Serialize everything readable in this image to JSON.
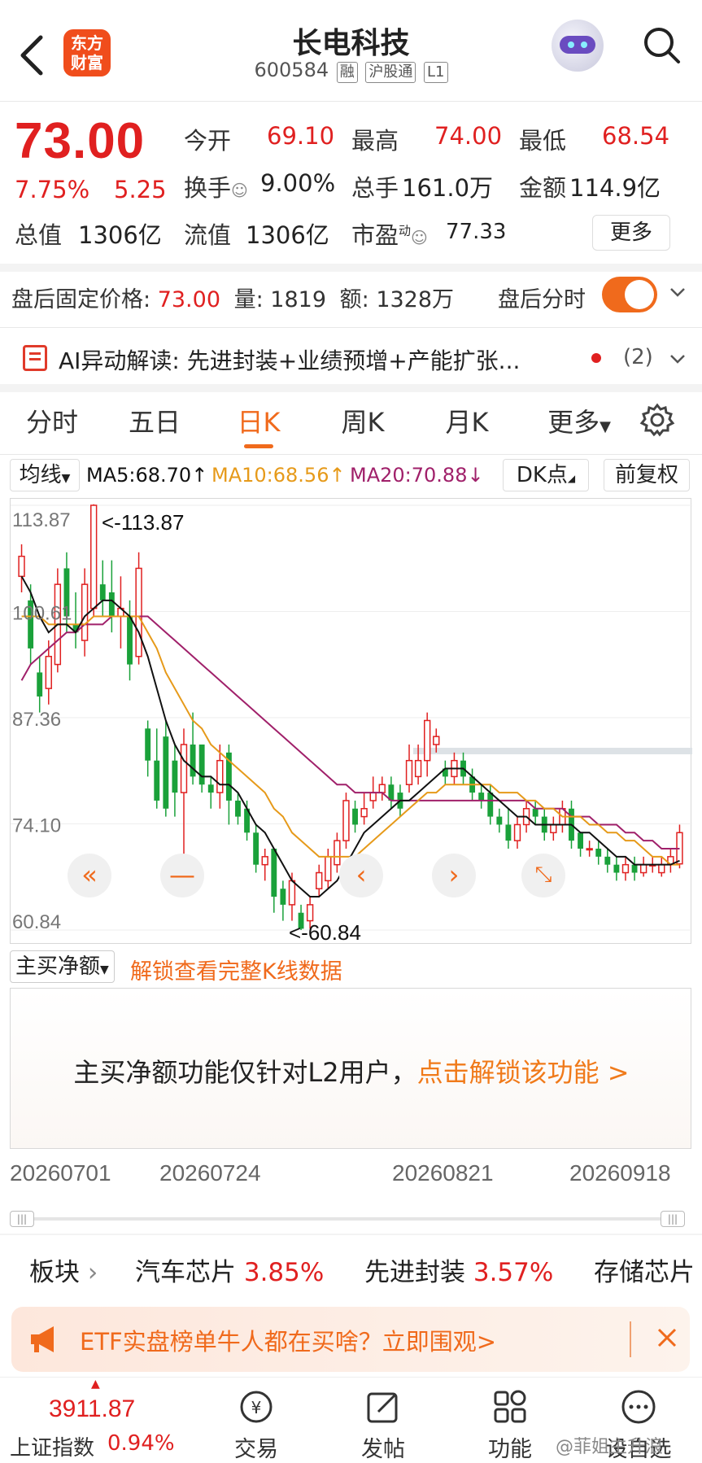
{
  "header": {
    "app_logo_line1": "东方",
    "app_logo_line2": "财富",
    "stock_name": "长电科技",
    "stock_code": "600584",
    "tag_rong": "融",
    "tag_hgt": "沪股通",
    "tag_level": "L1"
  },
  "quote": {
    "price": "73.00",
    "change_pct": "7.75%",
    "change_amt": "5.25",
    "open_label": "今开",
    "open": "69.10",
    "high_label": "最高",
    "high": "74.00",
    "low_label": "最低",
    "low": "68.54",
    "turnover_label": "换手",
    "turnover": "9.00%",
    "volume_label": "总手",
    "volume": "161.0万",
    "amount_label": "金额",
    "amount": "114.9亿",
    "mktcap_label": "总值",
    "mktcap": "1306亿",
    "float_label": "流值",
    "float_cap": "1306亿",
    "pe_label": "市盈",
    "pe_sup": "动",
    "pe": "77.33",
    "more_label": "更多"
  },
  "after_hours": {
    "price_label": "盘后固定价格:",
    "price": "73.00",
    "vol_label": "量:",
    "vol": "1819",
    "amt_label": "额:",
    "amt": "1328万",
    "toggle_label": "盘后分时",
    "toggle_on": true
  },
  "ai_row": {
    "text": "AI异动解读: 先进封装+业绩预增+产能扩张...",
    "count": "(2)"
  },
  "tabs": [
    {
      "label": "分时"
    },
    {
      "label": "五日"
    },
    {
      "label": "日K"
    },
    {
      "label": "周K"
    },
    {
      "label": "月K"
    },
    {
      "label": "更多"
    }
  ],
  "active_tab": "日K",
  "ma_bar": {
    "selector": "均线",
    "ma5": "MA5:68.70↑",
    "ma10": "MA10:68.56↑",
    "ma20": "MA20:70.88↓",
    "dk_label": "DK点",
    "adjust_label": "前复权"
  },
  "colors": {
    "up": "#e02020",
    "down": "#1aa13a",
    "accent": "#f06a1c",
    "ma5": "#111111",
    "ma10": "#e69a1a",
    "ma20": "#a0206a"
  },
  "chart_data": {
    "type": "candlestick",
    "y_ticks": [
      "113.87",
      "100.61",
      "87.36",
      "74.10",
      "60.84"
    ],
    "ylim": [
      60.84,
      113.87
    ],
    "max_label": "<-113.87",
    "min_label": "<-60.84",
    "x_labels": [
      "20260701",
      "20260724",
      "20260821",
      "20260918"
    ],
    "candles": [
      [
        105,
        107.5,
        103,
        109
      ],
      [
        102,
        96,
        94,
        104
      ],
      [
        93,
        90,
        88,
        95
      ],
      [
        91,
        95,
        89,
        97
      ],
      [
        94,
        104,
        93,
        106
      ],
      [
        106,
        100,
        98,
        108
      ],
      [
        99,
        98,
        96,
        103
      ],
      [
        97,
        104,
        95,
        106
      ],
      [
        101,
        113.87,
        100,
        114
      ],
      [
        104,
        102,
        100,
        107
      ],
      [
        103,
        100,
        98,
        107
      ],
      [
        100,
        101,
        96,
        105
      ],
      [
        100,
        94,
        92,
        102
      ],
      [
        95,
        106,
        94,
        108
      ],
      [
        86,
        82,
        80,
        87
      ],
      [
        82,
        77,
        76,
        86
      ],
      [
        85,
        76,
        75,
        87
      ],
      [
        82,
        78,
        75,
        84
      ],
      [
        78,
        84,
        70,
        86
      ],
      [
        84,
        80,
        79,
        88
      ],
      [
        84,
        79,
        78,
        84
      ],
      [
        79,
        78,
        76,
        80
      ],
      [
        78,
        82,
        76,
        84
      ],
      [
        83,
        77,
        74,
        84
      ],
      [
        77,
        75,
        74,
        78
      ],
      [
        76,
        73,
        72,
        77
      ],
      [
        73,
        69,
        68,
        74
      ],
      [
        69,
        70,
        67,
        71
      ],
      [
        71,
        65,
        63,
        71
      ],
      [
        66,
        64,
        62,
        67
      ],
      [
        64,
        67,
        62,
        68
      ],
      [
        63,
        61,
        60.84,
        64
      ],
      [
        62,
        64,
        61,
        65
      ],
      [
        66,
        68,
        65,
        69
      ],
      [
        67,
        70,
        66,
        71
      ],
      [
        69,
        72,
        68,
        73
      ],
      [
        72,
        77,
        71,
        78
      ],
      [
        76,
        74,
        73,
        77
      ],
      [
        75,
        76,
        74,
        78
      ],
      [
        77,
        78,
        76,
        80
      ],
      [
        78,
        79,
        77,
        80
      ],
      [
        79,
        77,
        76,
        80
      ],
      [
        78,
        76,
        75,
        79
      ],
      [
        79,
        82,
        78,
        84
      ],
      [
        80,
        82,
        79,
        84
      ],
      [
        82,
        87,
        80,
        88
      ],
      [
        84,
        85,
        83,
        86
      ],
      [
        81,
        80,
        79,
        82
      ],
      [
        80,
        82,
        79,
        83
      ],
      [
        82,
        80,
        79,
        83
      ],
      [
        80,
        78,
        77,
        81
      ],
      [
        78,
        77,
        76,
        79
      ],
      [
        78,
        75,
        74,
        79
      ],
      [
        75,
        74,
        73,
        76
      ],
      [
        74,
        72,
        71,
        76
      ],
      [
        72,
        74,
        71,
        75
      ],
      [
        74,
        76,
        73,
        77
      ],
      [
        76,
        75,
        74,
        77
      ],
      [
        75,
        73,
        72,
        76
      ],
      [
        73,
        74,
        72,
        75
      ],
      [
        74,
        76,
        73,
        77
      ],
      [
        76,
        72,
        71,
        77
      ],
      [
        73,
        71,
        70,
        73
      ],
      [
        71,
        71,
        70,
        72
      ],
      [
        71,
        70,
        69,
        72
      ],
      [
        70,
        69,
        68,
        71
      ],
      [
        69,
        68,
        67,
        70
      ],
      [
        68,
        69,
        67,
        70
      ],
      [
        69,
        68,
        67,
        70
      ],
      [
        68,
        69,
        67.5,
        70
      ],
      [
        69,
        69,
        68,
        70
      ],
      [
        68,
        69,
        67.5,
        70
      ],
      [
        69,
        70,
        68,
        71
      ],
      [
        69.1,
        73,
        68.54,
        74
      ]
    ],
    "ma5": [
      105,
      103,
      100,
      98,
      99,
      99,
      98,
      100,
      101,
      102,
      102,
      101,
      100,
      98,
      95,
      91,
      87,
      84,
      82,
      81,
      80,
      80,
      79,
      79,
      78,
      76,
      74,
      73,
      71,
      69,
      67,
      66,
      65,
      65,
      66,
      67,
      69,
      71,
      73,
      74,
      75,
      76,
      77,
      77,
      78,
      79,
      80,
      81,
      81,
      81,
      80,
      79,
      78,
      77,
      76,
      75,
      75,
      74,
      74,
      74,
      74,
      74,
      73,
      73,
      72,
      71,
      70,
      70,
      69,
      69,
      69,
      69,
      69,
      69.5
    ],
    "ma10": [
      100,
      100,
      100,
      99,
      99,
      99,
      99,
      99,
      100,
      100,
      100,
      100,
      100,
      100,
      98,
      96,
      93,
      91,
      89,
      87,
      86,
      84,
      83,
      82,
      81,
      80,
      79,
      78,
      76,
      75,
      73,
      72,
      71,
      70,
      70,
      70,
      70,
      70,
      71,
      72,
      73,
      74,
      75,
      76,
      77,
      78,
      78,
      79,
      79,
      79,
      79,
      79,
      79,
      78,
      78,
      78,
      77,
      77,
      76,
      76,
      75,
      75,
      75,
      74,
      74,
      73,
      73,
      72,
      72,
      71,
      70,
      70,
      69,
      69
    ],
    "ma20": [
      92,
      94,
      95,
      96,
      97,
      98,
      98,
      99,
      99,
      99,
      100,
      100,
      100,
      100,
      100,
      99,
      98,
      97,
      96,
      95,
      94,
      93,
      92,
      91,
      90,
      89,
      88,
      87,
      86,
      85,
      84,
      83,
      82,
      81,
      80,
      79,
      79,
      78,
      78,
      78,
      78,
      77,
      77,
      77,
      77,
      77,
      77,
      77,
      77,
      77,
      77,
      77,
      77,
      77,
      77,
      77,
      77,
      76,
      76,
      76,
      76,
      75,
      75,
      75,
      74,
      74,
      74,
      73,
      73,
      72,
      72,
      71,
      71,
      71
    ]
  },
  "main_buy": {
    "selector": "主买净额",
    "unlock_link": "解锁查看完整K线数据",
    "msg_prefix": "主买净额功能仅针对L2用户，",
    "msg_link": "点击解锁该功能 >"
  },
  "sectors": {
    "label": "板块",
    "items": [
      {
        "name": "汽车芯片",
        "pct": "3.85%"
      },
      {
        "name": "先进封装",
        "pct": "3.57%"
      },
      {
        "name": "存储芯片",
        "pct": ""
      }
    ]
  },
  "banner": {
    "text": "ETF实盘榜单牛人都在买啥？立即围观>"
  },
  "bottom_nav": {
    "index_value": "3911.87",
    "index_name": "上证指数",
    "index_pct": "0.94%",
    "items": [
      {
        "label": "交易",
        "icon": "yuan-exchange-icon"
      },
      {
        "label": "发帖",
        "icon": "edit-icon"
      },
      {
        "label": "功能",
        "icon": "grid-icon"
      },
      {
        "label": "设自选",
        "icon": "more-icon"
      }
    ]
  },
  "watermark": "@菲姐主升浪"
}
